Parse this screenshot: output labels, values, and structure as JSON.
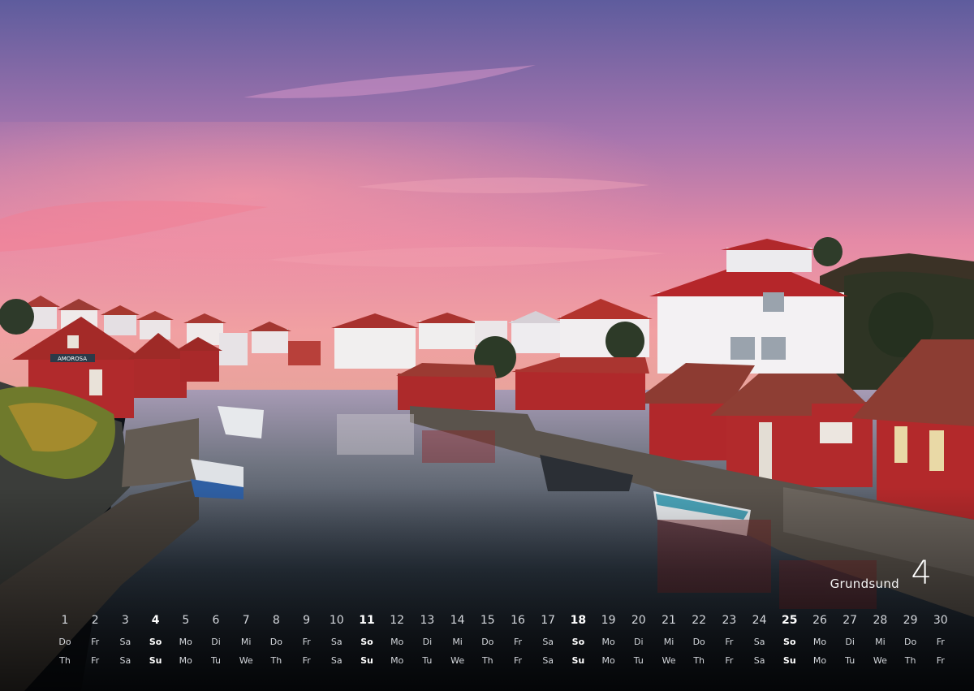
{
  "title": {
    "location": "Grundsund",
    "month": "4"
  },
  "calendar": {
    "days": [
      {
        "num": "1",
        "de": "Do",
        "en": "Th",
        "sun": false
      },
      {
        "num": "2",
        "de": "Fr",
        "en": "Fr",
        "sun": false
      },
      {
        "num": "3",
        "de": "Sa",
        "en": "Sa",
        "sun": false
      },
      {
        "num": "4",
        "de": "So",
        "en": "Su",
        "sun": true
      },
      {
        "num": "5",
        "de": "Mo",
        "en": "Mo",
        "sun": false
      },
      {
        "num": "6",
        "de": "Di",
        "en": "Tu",
        "sun": false
      },
      {
        "num": "7",
        "de": "Mi",
        "en": "We",
        "sun": false
      },
      {
        "num": "8",
        "de": "Do",
        "en": "Th",
        "sun": false
      },
      {
        "num": "9",
        "de": "Fr",
        "en": "Fr",
        "sun": false
      },
      {
        "num": "10",
        "de": "Sa",
        "en": "Sa",
        "sun": false
      },
      {
        "num": "11",
        "de": "So",
        "en": "Su",
        "sun": true
      },
      {
        "num": "12",
        "de": "Mo",
        "en": "Mo",
        "sun": false
      },
      {
        "num": "13",
        "de": "Di",
        "en": "Tu",
        "sun": false
      },
      {
        "num": "14",
        "de": "Mi",
        "en": "We",
        "sun": false
      },
      {
        "num": "15",
        "de": "Do",
        "en": "Th",
        "sun": false
      },
      {
        "num": "16",
        "de": "Fr",
        "en": "Fr",
        "sun": false
      },
      {
        "num": "17",
        "de": "Sa",
        "en": "Sa",
        "sun": false
      },
      {
        "num": "18",
        "de": "So",
        "en": "Su",
        "sun": true
      },
      {
        "num": "19",
        "de": "Mo",
        "en": "Mo",
        "sun": false
      },
      {
        "num": "20",
        "de": "Di",
        "en": "Tu",
        "sun": false
      },
      {
        "num": "21",
        "de": "Mi",
        "en": "We",
        "sun": false
      },
      {
        "num": "22",
        "de": "Do",
        "en": "Th",
        "sun": false
      },
      {
        "num": "23",
        "de": "Fr",
        "en": "Fr",
        "sun": false
      },
      {
        "num": "24",
        "de": "Sa",
        "en": "Sa",
        "sun": false
      },
      {
        "num": "25",
        "de": "So",
        "en": "Su",
        "sun": true
      },
      {
        "num": "26",
        "de": "Mo",
        "en": "Mo",
        "sun": false
      },
      {
        "num": "27",
        "de": "Di",
        "en": "Tu",
        "sun": false
      },
      {
        "num": "28",
        "de": "Mi",
        "en": "We",
        "sun": false
      },
      {
        "num": "29",
        "de": "Do",
        "en": "Th",
        "sun": false
      },
      {
        "num": "30",
        "de": "Fr",
        "en": "Fr",
        "sun": false
      }
    ]
  },
  "sign": {
    "text": "AMOROSA"
  },
  "colors": {
    "sky_top": "#6f63a8",
    "sky_mid": "#c584b6",
    "sky_glow": "#f39aa1",
    "water": "#3f4c59",
    "house_red": "#b3262b",
    "roof_red": "#a3322c",
    "house_white": "#eeeeee"
  }
}
